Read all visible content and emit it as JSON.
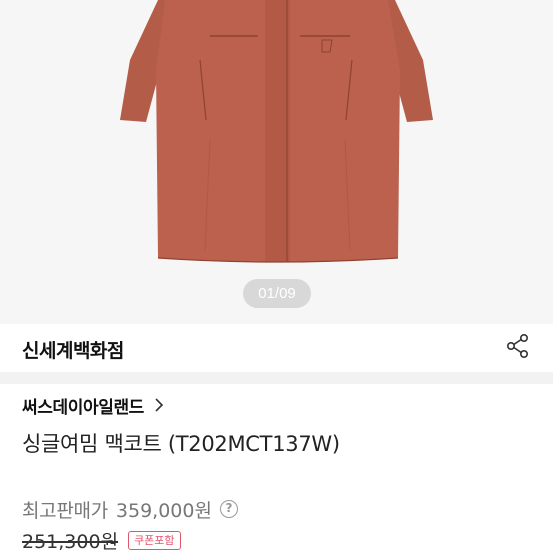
{
  "gallery": {
    "page_indicator": "01/09"
  },
  "store": {
    "name": "신세계백화점"
  },
  "product": {
    "brand": "써스데이아일랜드",
    "title": "싱글여밈 맥코트 (T202MCT137W)"
  },
  "price": {
    "label": "최고판매가",
    "value": "359,000원",
    "original": "251,300원",
    "coupon_badge": "쿠폰포함"
  },
  "colors": {
    "coat": "#b85f4b",
    "coupon_accent": "#e0566b"
  },
  "icons": {
    "share": "share-icon",
    "chevron": "chevron-right-icon",
    "help": "question-circle-icon"
  }
}
